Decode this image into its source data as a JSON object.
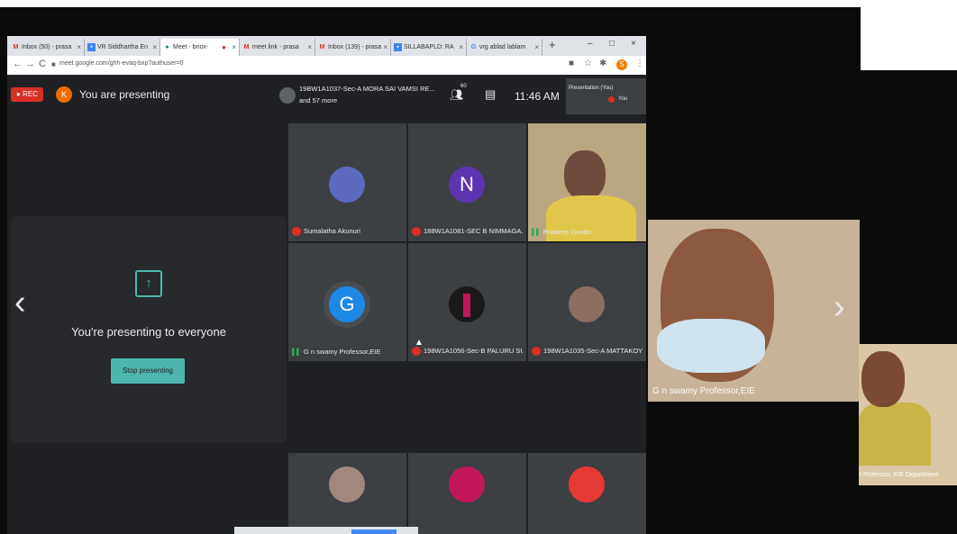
{
  "browser": {
    "tabs": [
      {
        "icon": "gmail-icon",
        "label": "Inbox (50) - prasa"
      },
      {
        "icon": "doc-icon",
        "label": "VR Siddhartha En"
      },
      {
        "icon": "meet-icon",
        "label": "Meet - bnox-"
      },
      {
        "icon": "gmail-icon",
        "label": "meet link - prasa"
      },
      {
        "icon": "gmail-icon",
        "label": "Inbox (139) - prasa"
      },
      {
        "icon": "doc-icon",
        "label": "SILLABAPLD: RA"
      },
      {
        "icon": "google-icon",
        "label": "vrg ablad lablam"
      }
    ],
    "url": "meet.google.com/ghh-evaq-bxp?authuser=0",
    "profile_initial": "S"
  },
  "meet": {
    "rec_label": "REC",
    "presenter_initial": "K",
    "presenting_status": "You are presenting",
    "participants_line1": "19BW1A1037-Sec-A MORA SAI VAMSI RE...",
    "participants_line2": "and 57 more",
    "people_count": "60",
    "time": "11:46 AM",
    "presentation_thumb_label": "Presentation (You)",
    "presentation_thumb_you": "You"
  },
  "present_panel": {
    "title": "You're presenting to everyone",
    "stop_button": "Stop presenting"
  },
  "tiles": [
    {
      "name": "Sumalatha Akunuri",
      "initial": "",
      "avatar_color": "#5c6bc0",
      "muted": true
    },
    {
      "name": "188W1A1081-SEC B NIMMAGA...",
      "initial": "N",
      "avatar_color": "#5e35b1",
      "muted": true
    },
    {
      "name": "Pradeep Gunda",
      "initial": "",
      "avatar_color": "#c8b25a",
      "muted": false
    },
    {
      "name": "G n swamy Professor,EIE",
      "initial": "G",
      "avatar_color": "#1e88e5",
      "muted": false
    },
    {
      "name": "198W1A1056-Sec-B PALURU SU...",
      "initial": "",
      "avatar_color": "#ad1457",
      "muted": true
    },
    {
      "name": "198W1A1035-Sec-A MATTAKOY...",
      "initial": "",
      "avatar_color": "#8d6e63",
      "muted": true
    },
    {
      "name": "",
      "initial": "",
      "avatar_color": "#a1887f",
      "muted": false
    },
    {
      "name": "",
      "initial": "",
      "avatar_color": "#c2185b",
      "muted": false
    },
    {
      "name": "",
      "initial": "",
      "avatar_color": "#e53935",
      "muted": false
    }
  ],
  "big_video": {
    "label": "G n swamy Professor,EIE"
  },
  "small_video": {
    "label": "t Professor, EIE Department"
  }
}
